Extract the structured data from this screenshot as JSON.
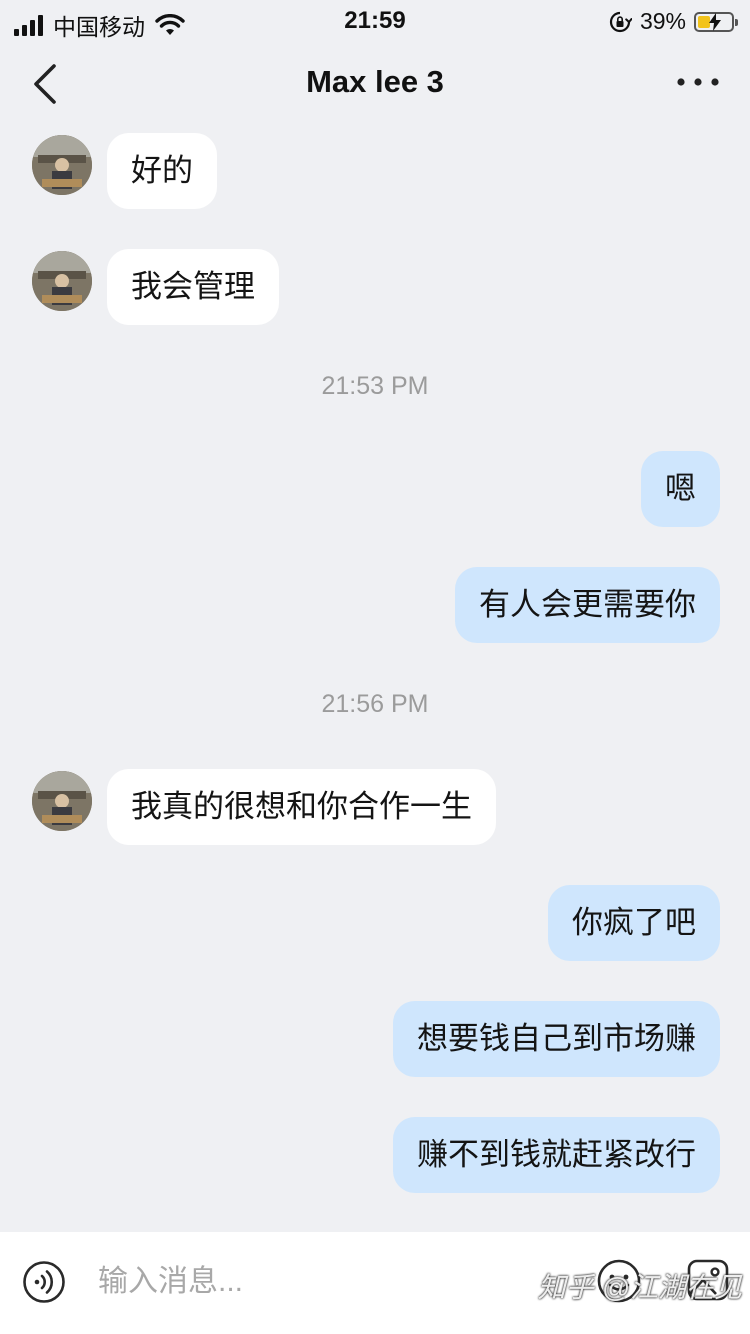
{
  "status_bar": {
    "carrier": "中国移动",
    "time": "21:59",
    "battery_percent": "39%",
    "battery_level": 0.39,
    "icons": [
      "signal-icon",
      "wifi-icon",
      "rotation-lock-icon",
      "battery-charging-icon"
    ]
  },
  "nav": {
    "title": "Max lee 3",
    "back_icon": "chevron-left-icon",
    "more_icon": "more-dots-icon"
  },
  "messages": [
    {
      "side": "in",
      "text": "好的"
    },
    {
      "side": "in",
      "text": "我会管理"
    },
    {
      "type": "time",
      "text": "21:53 PM"
    },
    {
      "side": "out",
      "text": "嗯"
    },
    {
      "side": "out",
      "text": "有人会更需要你"
    },
    {
      "type": "time",
      "text": "21:56 PM"
    },
    {
      "side": "in",
      "text": "我真的很想和你合作一生"
    },
    {
      "side": "out",
      "text": "你疯了吧"
    },
    {
      "side": "out",
      "text": "想要钱自己到市场赚"
    },
    {
      "side": "out",
      "text": "赚不到钱就赶紧改行"
    }
  ],
  "input_bar": {
    "placeholder": "输入消息...",
    "value": "",
    "watermark": "知乎 @江湖在见"
  },
  "colors": {
    "background": "#eff0f3",
    "incoming_bubble": "#ffffff",
    "outgoing_bubble": "#cfe6fd",
    "timestamp_text": "#9b9b9b"
  }
}
